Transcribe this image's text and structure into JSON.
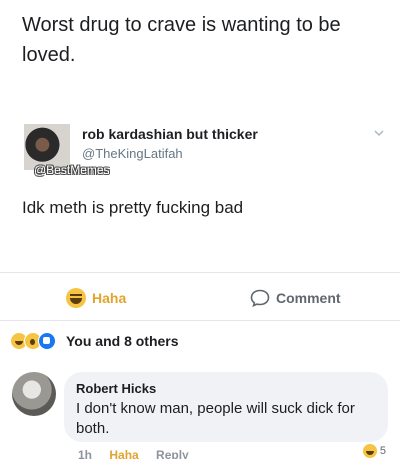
{
  "post": {
    "text": "Worst drug to crave is wanting to be loved."
  },
  "tweet": {
    "name": "rob kardashian but thicker",
    "handle": "@TheKingLatifah",
    "watermark": "@BestMemes",
    "text": "Idk meth is pretty fucking bad"
  },
  "actions": {
    "haha_label": "Haha",
    "comment_label": "Comment"
  },
  "reactions": {
    "summary": "You and 8 others"
  },
  "comment": {
    "author": "Robert Hicks",
    "text": "I don't know man, people will suck dick for both.",
    "time": "1h",
    "haha_label": "Haha",
    "reply_label": "Reply",
    "reaction_count": "5"
  },
  "colors": {
    "haha_accent": "#e0a42f",
    "meta_gray": "#8d949e",
    "bubble": "#f0f2f5"
  }
}
